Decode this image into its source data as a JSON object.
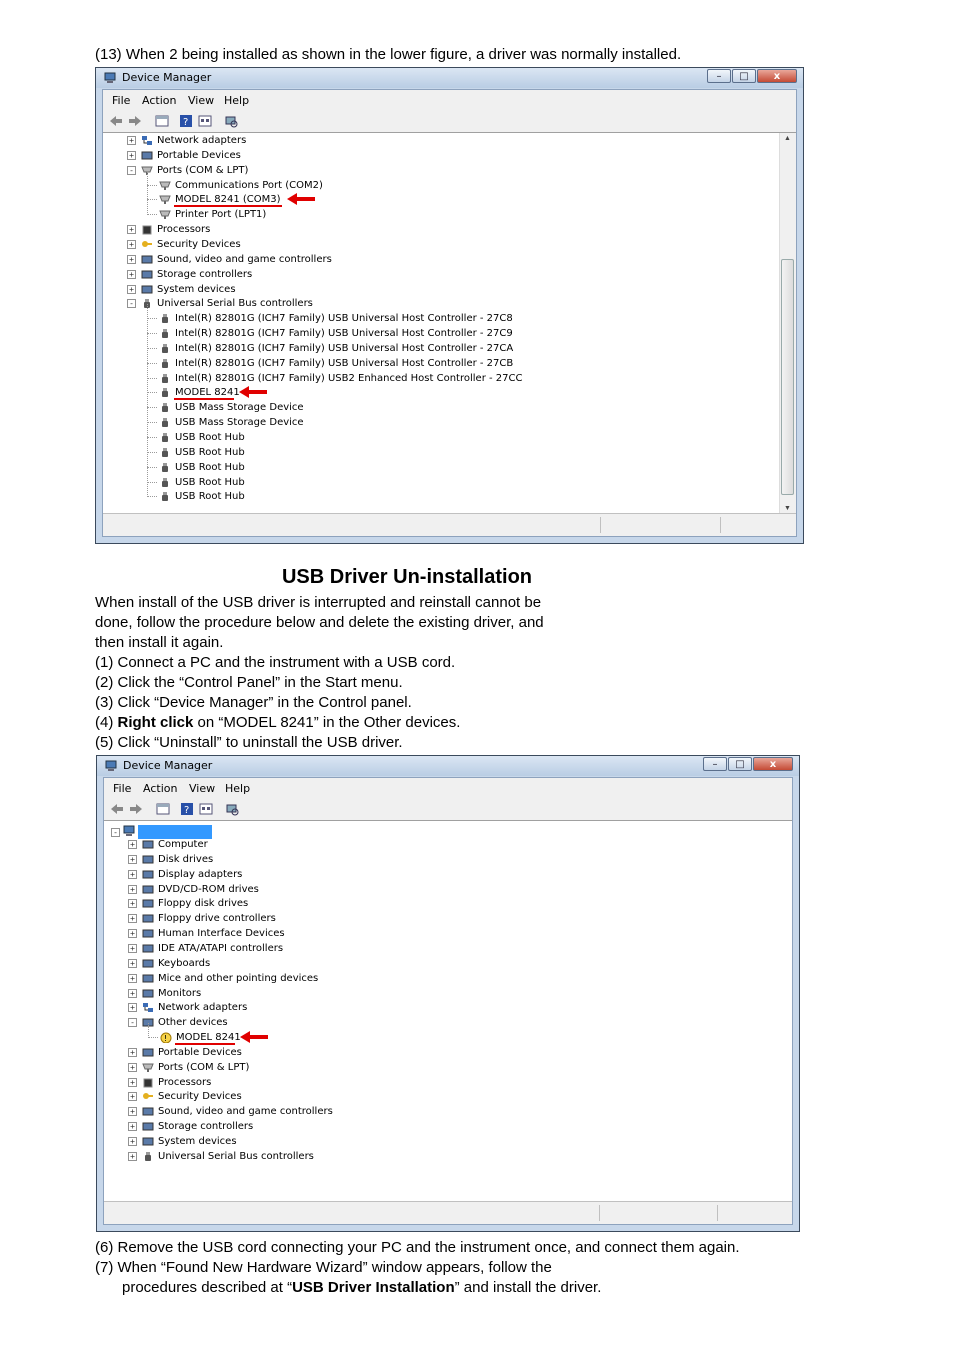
{
  "step13": "(13)  When 2 being installed as shown in the lower figure, a driver was normally installed.",
  "window1": {
    "title": "Device Manager",
    "menu": [
      "File",
      "Action",
      "View",
      "Help"
    ],
    "rows": [
      {
        "label": "Network adapters",
        "icon": "network-icon"
      },
      {
        "label": "Portable Devices",
        "icon": "portable-device-icon"
      },
      {
        "label": "Ports (COM & LPT)",
        "icon": "port-icon"
      },
      {
        "label": "Communications Port (COM2)",
        "icon": "port-icon"
      },
      {
        "label": "MODEL 8241 (COM3)",
        "icon": "port-icon"
      },
      {
        "label": "Printer Port (LPT1)",
        "icon": "port-icon"
      },
      {
        "label": "Processors",
        "icon": "processor-icon"
      },
      {
        "label": "Security Devices",
        "icon": "security-icon"
      },
      {
        "label": "Sound, video and game controllers",
        "icon": "sound-icon"
      },
      {
        "label": "Storage controllers",
        "icon": "storage-icon"
      },
      {
        "label": "System devices",
        "icon": "system-icon"
      },
      {
        "label": "Universal Serial Bus controllers",
        "icon": "usb-icon"
      },
      {
        "label": "Intel(R) 82801G (ICH7 Family) USB Universal Host Controller - 27C8",
        "icon": "usb-icon"
      },
      {
        "label": "Intel(R) 82801G (ICH7 Family) USB Universal Host Controller - 27C9",
        "icon": "usb-icon"
      },
      {
        "label": "Intel(R) 82801G (ICH7 Family) USB Universal Host Controller - 27CA",
        "icon": "usb-icon"
      },
      {
        "label": "Intel(R) 82801G (ICH7 Family) USB Universal Host Controller - 27CB",
        "icon": "usb-icon"
      },
      {
        "label": "Intel(R) 82801G (ICH7 Family) USB2 Enhanced Host Controller - 27CC",
        "icon": "usb-icon"
      },
      {
        "label": "MODEL 8241",
        "icon": "usb-icon"
      },
      {
        "label": "USB Mass Storage Device",
        "icon": "usb-icon"
      },
      {
        "label": "USB Mass Storage Device",
        "icon": "usb-icon"
      },
      {
        "label": "USB Root Hub",
        "icon": "usb-icon"
      },
      {
        "label": "USB Root Hub",
        "icon": "usb-icon"
      },
      {
        "label": "USB Root Hub",
        "icon": "usb-icon"
      },
      {
        "label": "USB Root Hub",
        "icon": "usb-icon"
      },
      {
        "label": "USB Root Hub",
        "icon": "usb-icon"
      }
    ]
  },
  "heading": "USB Driver Un-installation",
  "intro": [
    "When install of the USB driver is interrupted and reinstall cannot be",
    "done, follow the procedure below and delete the existing driver, and",
    "then install it again."
  ],
  "steps": {
    "s1": "(1)  Connect a PC and the instrument with a USB cord.",
    "s2": "(2)  Click the “Control Panel” in the Start menu.",
    "s3": "(3)  Click “Device Manager” in the Control panel.",
    "s4_pre": "(4)  ",
    "s4_bold": "Right click",
    "s4_post": " on “MODEL 8241” in the Other devices.",
    "s5": "(5)  Click “Uninstall” to uninstall the USB driver."
  },
  "window2": {
    "title": "Device Manager",
    "menu": [
      "File",
      "Action",
      "View",
      "Help"
    ],
    "rows": [
      {
        "label": "Computer",
        "icon": "computer-icon"
      },
      {
        "label": "Disk drives",
        "icon": "disk-icon"
      },
      {
        "label": "Display adapters",
        "icon": "display-icon"
      },
      {
        "label": "DVD/CD-ROM drives",
        "icon": "dvd-icon"
      },
      {
        "label": "Floppy disk drives",
        "icon": "floppy-icon"
      },
      {
        "label": "Floppy drive controllers",
        "icon": "floppy-icon"
      },
      {
        "label": "Human Interface Devices",
        "icon": "hid-icon"
      },
      {
        "label": "IDE ATA/ATAPI controllers",
        "icon": "ide-icon"
      },
      {
        "label": "Keyboards",
        "icon": "keyboard-icon"
      },
      {
        "label": "Mice and other pointing devices",
        "icon": "mouse-icon"
      },
      {
        "label": "Monitors",
        "icon": "monitor-icon"
      },
      {
        "label": "Network adapters",
        "icon": "network-icon"
      },
      {
        "label": "Other devices",
        "icon": "other-device-icon"
      },
      {
        "label": "MODEL 8241",
        "icon": "warning-device-icon"
      },
      {
        "label": "Portable Devices",
        "icon": "portable-device-icon"
      },
      {
        "label": "Ports (COM & LPT)",
        "icon": "port-icon"
      },
      {
        "label": "Processors",
        "icon": "processor-icon"
      },
      {
        "label": "Security Devices",
        "icon": "security-icon"
      },
      {
        "label": "Sound, video and game controllers",
        "icon": "sound-icon"
      },
      {
        "label": "Storage controllers",
        "icon": "storage-icon"
      },
      {
        "label": "System devices",
        "icon": "system-icon"
      },
      {
        "label": "Universal Serial Bus controllers",
        "icon": "usb-icon"
      }
    ]
  },
  "footer": {
    "s6": "(6)  Remove the USB cord connecting your PC and the instrument once, and connect them again.",
    "s7a": "(7)  When “Found New Hardware Wizard” window appears, follow the",
    "s7b_pre": "procedures described at “",
    "s7b_bold": "USB Driver Installation",
    "s7b_post": "” and install the driver."
  },
  "colors": {
    "highlight_red": "#e00000",
    "selection_blue": "#3399ff"
  }
}
